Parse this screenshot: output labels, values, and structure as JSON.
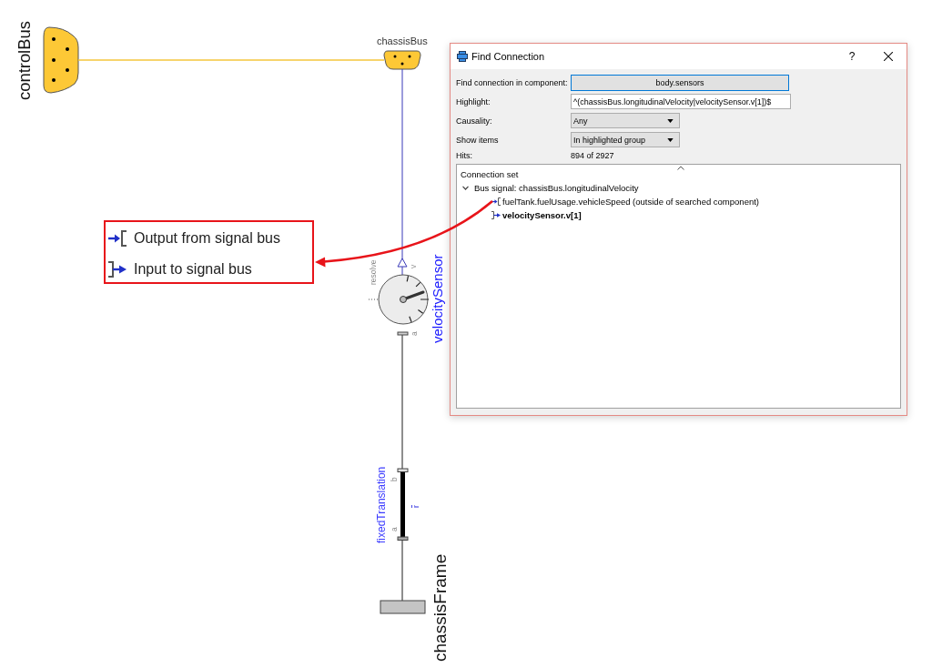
{
  "diagram": {
    "control_bus": {
      "label": "controlBus"
    },
    "chassis_bus": {
      "label": "chassisBus"
    },
    "velocity_sensor": {
      "label": "velocitySensor",
      "resolve_port": "resolve",
      "output_port": "v",
      "flange_port": "a"
    },
    "fixed_translation": {
      "label": "fixedTranslation",
      "flange_b": "b",
      "flange_a": "a",
      "vector": "r"
    },
    "chassis_frame": {
      "label": "chassisFrame"
    }
  },
  "legend": {
    "items": [
      {
        "kind": "output",
        "label": "Output from signal bus"
      },
      {
        "kind": "input",
        "label": "Input to signal bus"
      }
    ]
  },
  "dialog": {
    "title": "Find Connection",
    "help_button": "?",
    "fields": [
      {
        "kind": "button",
        "label": "Find connection in component:",
        "value": "body.sensors"
      },
      {
        "kind": "text",
        "label": "Highlight:",
        "value": "^(chassisBus.longitudinalVelocity|velocitySensor.v[1])$"
      },
      {
        "kind": "combo",
        "label": "Causality:",
        "value": "Any"
      },
      {
        "kind": "combo",
        "label": "Show items",
        "value": "In highlighted group"
      },
      {
        "kind": "readout",
        "label": "Hits:",
        "value": "894 of 2927"
      }
    ],
    "tree": {
      "header": "Connection set",
      "items": [
        {
          "label": "Bus signal: chassisBus.longitudinalVelocity",
          "expanded": true,
          "children": [
            {
              "kind": "output",
              "label": "fuelTank.fuelUsage.vehicleSpeed (outside of searched component)",
              "highlighted": false
            },
            {
              "kind": "input",
              "label": "velocitySensor.v[1]",
              "highlighted": true
            }
          ]
        }
      ]
    }
  }
}
